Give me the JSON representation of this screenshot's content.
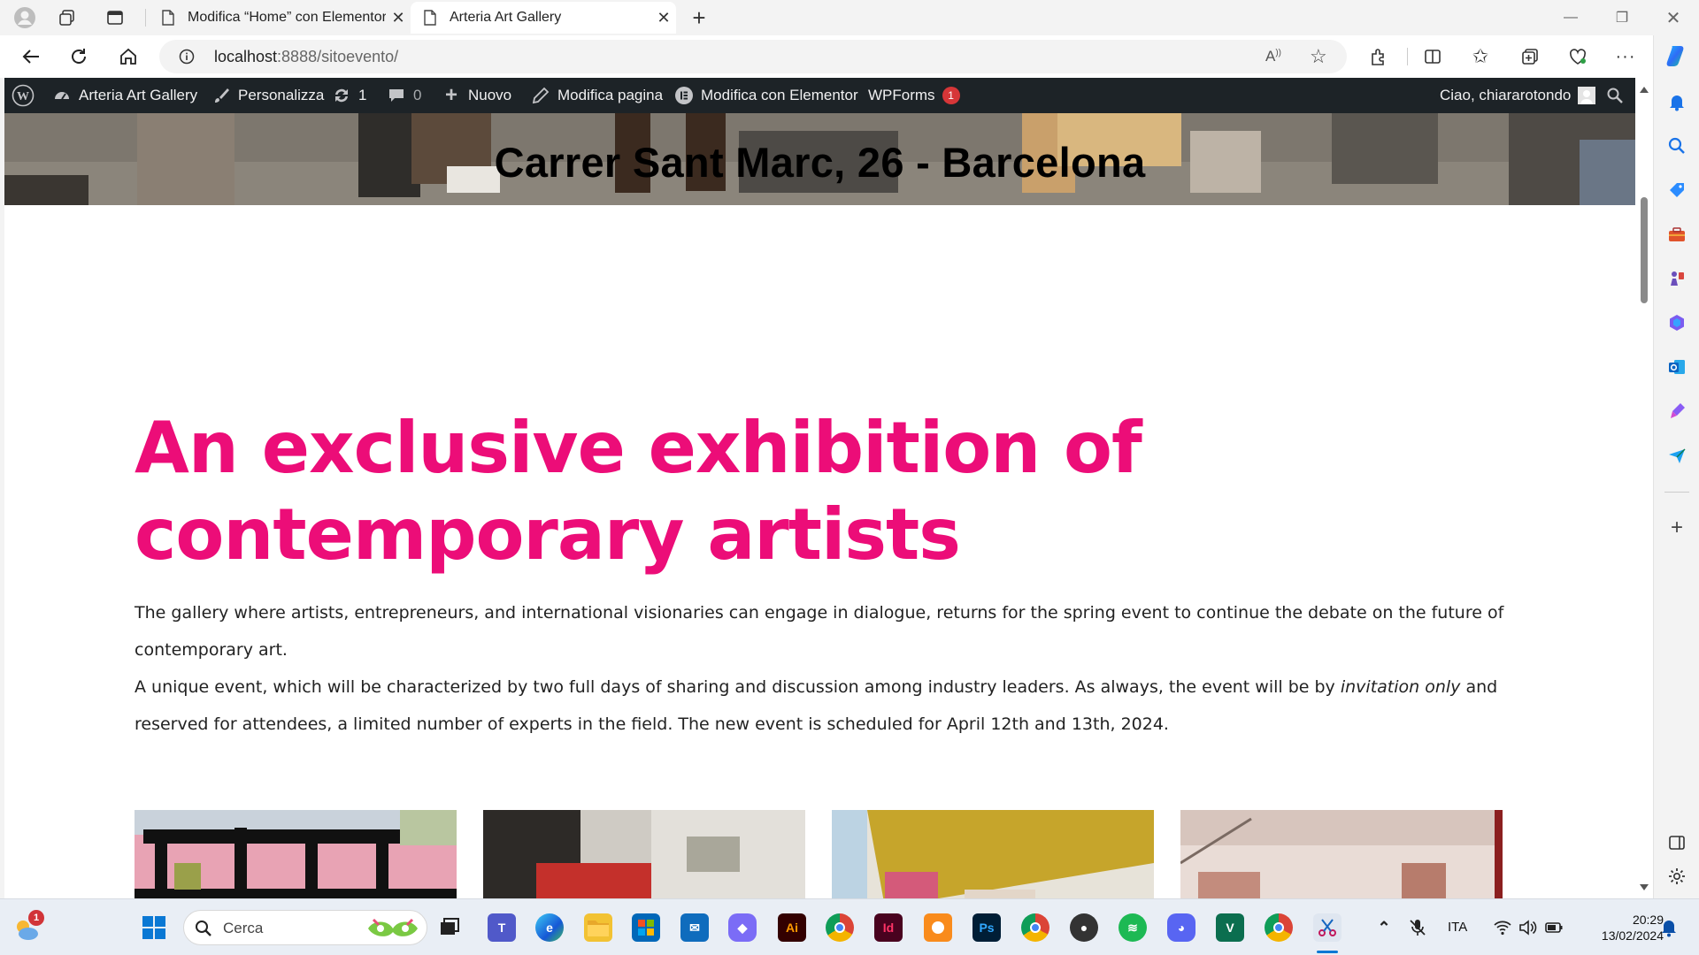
{
  "browser": {
    "tabs": [
      {
        "title": "Modifica “Home” con Elementor",
        "active": false
      },
      {
        "title": "Arteria Art Gallery",
        "active": true
      }
    ],
    "url_host": "localhost",
    "url_rest": ":8888/sitoevento/"
  },
  "wp_admin_bar": {
    "site_name": "Arteria Art Gallery",
    "customize": "Personalizza",
    "updates_count": "1",
    "comments_count": "0",
    "new": "Nuovo",
    "edit_page": "Modifica pagina",
    "edit_elementor": "Modifica con Elementor",
    "wpforms": "WPForms",
    "wpforms_badge": "1",
    "greeting": "Ciao, chiararotondo"
  },
  "page": {
    "hero_title": "Carrer Sant Marc, 26 - Barcelona",
    "headline_line1": "An exclusive exhibition of",
    "headline_line2": "contemporary artists",
    "headline_color": "#ec0d78",
    "paragraph1": "The gallery where artists, entrepreneurs, and international visionaries can engage in dialogue, returns for the spring event to continue the debate on the future of contemporary art.",
    "paragraph2_before": "A unique event, which will be characterized by two full days of sharing and discussion among industry leaders. As always, the event will be by ",
    "paragraph2_italic": "invitation only",
    "paragraph2_after": " and reserved for attendees, a limited number of experts in the field. The new event is scheduled for April 12th and 13th, 2024."
  },
  "taskbar": {
    "weather_badge": "1",
    "search_placeholder": "Cerca",
    "language": "ITA",
    "time": "20:29",
    "date": "13/02/2024"
  }
}
